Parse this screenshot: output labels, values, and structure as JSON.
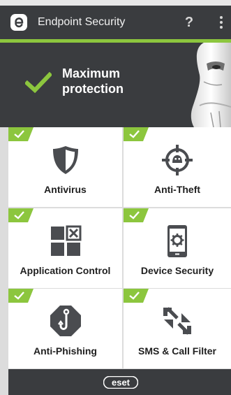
{
  "app": {
    "title": "Endpoint Security",
    "help_label": "?",
    "brand_icon": "eset-e-icon",
    "more_icon": "overflow-menu-icon"
  },
  "colors": {
    "bar": "#3a3c3f",
    "accent": "#8cc63e",
    "tile_bg": "#ffffff",
    "icon": "#4a4c50"
  },
  "status": {
    "text_line1": "Maximum",
    "text_line2": "protection",
    "icon": "checkmark-icon"
  },
  "tiles": [
    {
      "label": "Antivirus",
      "icon": "shield-icon",
      "protected": true
    },
    {
      "label": "Anti-Theft",
      "icon": "crosshair-robot-icon",
      "protected": true
    },
    {
      "label": "Application Control",
      "icon": "app-grid-icon",
      "protected": true
    },
    {
      "label": "Device Security",
      "icon": "phone-gear-icon",
      "protected": true
    },
    {
      "label": "Anti-Phishing",
      "icon": "hook-octagon-icon",
      "protected": true
    },
    {
      "label": "SMS & Call Filter",
      "icon": "call-arrows-icon",
      "protected": true
    }
  ],
  "footer": {
    "logo_text": "eset"
  }
}
